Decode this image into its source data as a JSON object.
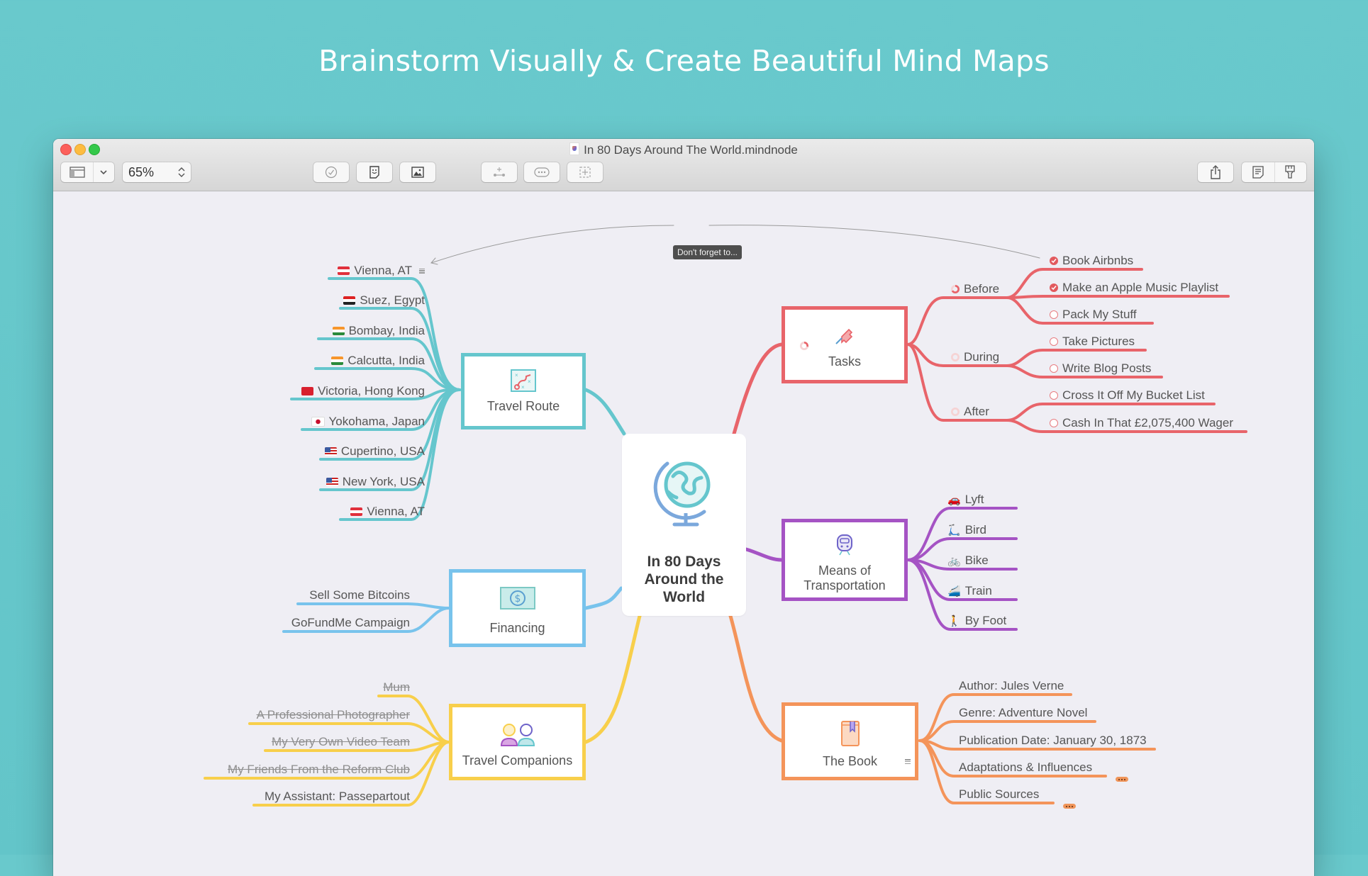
{
  "hero": {
    "title": "Brainstorm Visually & Create Beautiful Mind Maps"
  },
  "window": {
    "title": "In 80 Days Around The World.mindnode",
    "toolbar": {
      "sidebar_toggle_icon": "sidebar-icon",
      "sidebar_menu_icon": "chevron-down-icon",
      "zoom_value": "65%",
      "zoom_stepper_icon": "up-down-chevron-icon",
      "task_icon": "checkmark-circle-icon",
      "sticker_icon": "sticker-icon",
      "image_icon": "image-icon",
      "add_child_icon": "add-node-icon",
      "add_sibling_icon": "ellipsis-bubble-icon",
      "focus_icon": "focus-plus-icon",
      "share_icon": "share-icon",
      "notes_icon": "document-notes-icon",
      "style_icon": "paintbrush-icon"
    }
  },
  "colors": {
    "background": "#66c8cb",
    "canvas": "#efeef4",
    "travel_route": "#65c6cd",
    "tasks": "#e8646a",
    "transport": "#a553c4",
    "book": "#f4945a",
    "financing": "#78c3ec",
    "companions": "#f8cf4b"
  },
  "mindmap": {
    "central": {
      "label": "In 80 Days Around the World",
      "icon": "globe-icon"
    },
    "connection": {
      "label": "Don't forget to...",
      "from": "Book Airbnbs",
      "to": "Vienna, AT"
    },
    "travel_route": {
      "label": "Travel Route",
      "icon": "route-map-icon",
      "children": [
        {
          "label": "Vienna, AT",
          "flag": "AT",
          "has_note": true
        },
        {
          "label": "Suez, Egypt",
          "flag": "EG"
        },
        {
          "label": "Bombay, India",
          "flag": "IN"
        },
        {
          "label": "Calcutta, India",
          "flag": "IN"
        },
        {
          "label": "Victoria, Hong Kong",
          "flag": "HK"
        },
        {
          "label": "Yokohama, Japan",
          "flag": "JP"
        },
        {
          "label": "Cupertino, USA",
          "flag": "US"
        },
        {
          "label": "New York, USA",
          "flag": "US"
        },
        {
          "label": "Vienna, AT",
          "flag": "AT"
        }
      ]
    },
    "financing": {
      "label": "Financing",
      "icon": "dollar-bill-icon",
      "children": [
        {
          "label": "Sell Some Bitcoins"
        },
        {
          "label": "GoFundMe Campaign"
        }
      ]
    },
    "companions": {
      "label": "Travel Companions",
      "icon": "people-icon",
      "children": [
        {
          "label": "Mum",
          "struck": true
        },
        {
          "label": "A Professional Photographer",
          "struck": true
        },
        {
          "label": "My Very Own Video Team",
          "struck": true
        },
        {
          "label": "My Friends From the Reform Club",
          "struck": true
        },
        {
          "label": "My Assistant: Passepartout",
          "struck": false
        }
      ]
    },
    "tasks": {
      "label": "Tasks",
      "icon": "pushpin-icon",
      "progress": 0.29,
      "groups": [
        {
          "label": "Before",
          "progress": 0.67,
          "items": [
            {
              "label": "Book Airbnbs",
              "done": true
            },
            {
              "label": "Make an Apple Music Playlist",
              "done": true
            },
            {
              "label": "Pack My Stuff",
              "done": false
            }
          ]
        },
        {
          "label": "During",
          "progress": 0.0,
          "items": [
            {
              "label": "Take Pictures",
              "done": false
            },
            {
              "label": "Write Blog Posts",
              "done": false
            }
          ]
        },
        {
          "label": "After",
          "progress": 0.0,
          "items": [
            {
              "label": "Cross It Off My Bucket List",
              "done": false
            },
            {
              "label": "Cash In That £2,075,400 Wager",
              "done": false
            }
          ]
        }
      ]
    },
    "transport": {
      "label_line1": "Means of",
      "label_line2": "Transportation",
      "icon": "train-icon",
      "children": [
        {
          "label": "Lyft",
          "emoji": "🚗",
          "icon": "car-icon"
        },
        {
          "label": "Bird",
          "emoji": "🛴",
          "icon": "scooter-icon"
        },
        {
          "label": "Bike",
          "emoji": "🚲",
          "icon": "bicycle-icon"
        },
        {
          "label": "Train",
          "emoji": "🚄",
          "icon": "train-emoji-icon"
        },
        {
          "label": "By Foot",
          "emoji": "🚶",
          "icon": "walking-icon"
        }
      ]
    },
    "book": {
      "label": "The Book",
      "icon": "book-icon",
      "has_note": true,
      "children": [
        {
          "label": "Author: Jules Verne"
        },
        {
          "label": "Genre: Adventure Novel"
        },
        {
          "label": "Publication Date: January 30, 1873"
        },
        {
          "label": "Adaptations & Influences",
          "collapsed": true
        },
        {
          "label": "Public Sources",
          "collapsed": true
        }
      ]
    }
  }
}
